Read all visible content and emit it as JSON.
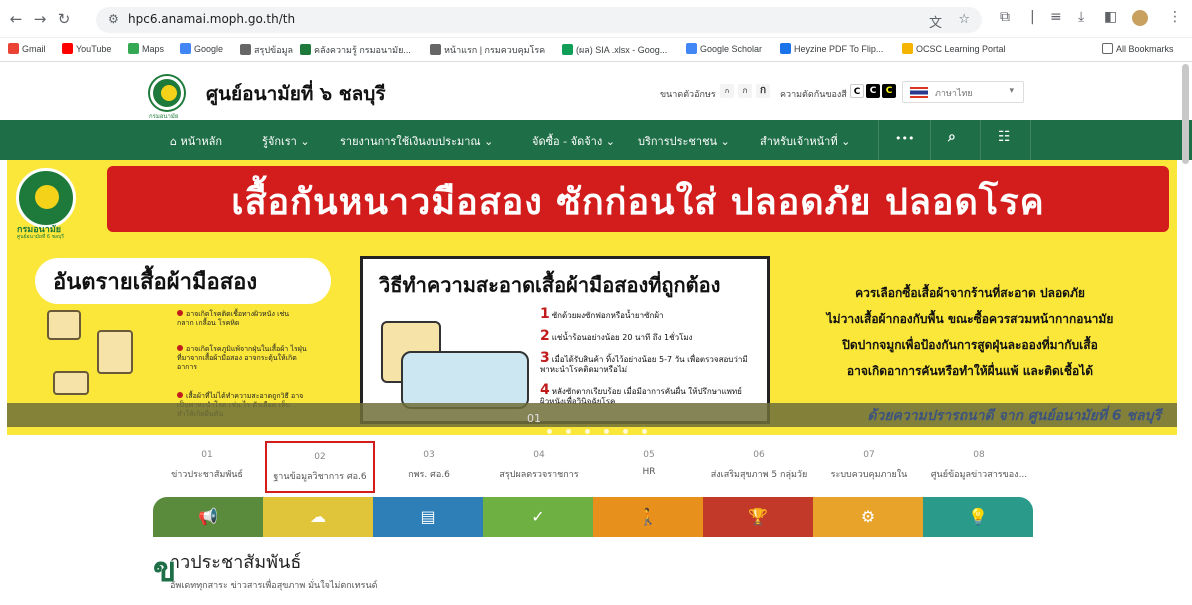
{
  "browser": {
    "url": "hpc6.anamai.moph.go.th/th",
    "bookmarks": [
      "Gmail",
      "YouTube",
      "Maps",
      "Google",
      "สรุปข้อมูล",
      "คลังความรู้ กรมอนามัย...",
      "หน้าแรก | กรมควบคุมโรค",
      "(ผล) SIA .xlsx - Goog...",
      "Google Scholar",
      "Heyzine PDF To Flip...",
      "OCSC Learning Portal"
    ],
    "all_bookmarks": "All Bookmarks"
  },
  "header": {
    "logo_caption": "กรมอนามัย",
    "site_title": "ศูนย์อนามัยที่ ๖ ชลบุรี",
    "font_size_label": "ขนาดตัวอักษร",
    "font_sizes": [
      "ก",
      "ก",
      "ก"
    ],
    "contrast_label": "ความตัดกันของสี",
    "contrast_buttons": [
      "C",
      "C",
      "C"
    ],
    "language": "ภาษาไทย"
  },
  "nav": {
    "items": [
      "หน้าหลัก",
      "รู้จักเรา ⌄",
      "รายงานการใช้เงินงบประมาณ ⌄",
      "จัดซื้อ - จัดจ้าง ⌄",
      "บริการประชาชน ⌄",
      "สำหรับเจ้าหน้าที่ ⌄",
      "•••"
    ]
  },
  "banner": {
    "title": "เสื้อกันหนาวมือสอง ซักก่อนใส่ ปลอดภัย ปลอดโรค",
    "logo_caption": "กรมอนามัย",
    "logo_caption2": "ศูนย์อนามัยที่ 6 ชลบุรี",
    "danger_title": "อันตรายเสื้อผ้ามือสอง",
    "bullets": [
      "อาจเกิดโรคติดเชื้อทางผิวหนัง เช่น กลาก เกลื้อน โรคหิด",
      "อาจเกิดโรคภูมิแพ้จากฝุ่นในเสื้อผ้า ไรฝุ่นที่มาจากเสื้อผ้ามือสอง อาจกระตุ้นให้เกิดอาการ",
      "เสื้อผ้าที่ไม่ได้ทำความสะอาดถูกวิธี อาจเป็นพาหะนำโรค เช่น ไร ตัวเลือด เห็บ ทำให้เกิดผื่นคัน"
    ],
    "clean_title": "วิธีทำความสะอาดเสื้อผ้ามือสองที่ถูกต้อง",
    "steps": [
      {
        "num": "1",
        "text": "ซักด้วยผงซักฟอกหรือน้ำยาซักผ้า"
      },
      {
        "num": "2",
        "text": "แช่น้ำร้อนอย่างน้อย 20 นาที ถึง 1ชั่วโมง"
      },
      {
        "num": "3",
        "text": "เมื่อได้รับสินค้า ทิ้งไว้อย่างน้อย 5-7 วัน เพื่อตรวจสอบว่ามีพาหะนำโรคติดมาหรือไม่"
      },
      {
        "num": "4",
        "text": "หลังซักตากเรียบร้อย เมื่อมีอาการคันผื่น ให้ปรึกษาแพทย์ผิวหนังเพื่อวินิจฉัยโรค"
      }
    ],
    "right_lines": [
      "ควรเลือกซื้อเสื้อผ้าจากร้านที่สะอาด ปลอดภัย",
      "ไม่วางเสื้อผ้ากองกับพื้น ขณะซื้อควรสวมหน้ากากอนามัย",
      "ปิดปากจมูกเพื่อป้องกันการสูดฝุ่นละอองที่มากับเสื้อ",
      "อาจเกิดอาการคันหรือทำให้ผื่นแพ้ และติดเชื้อได้"
    ],
    "footer_text": "ด้วยความปรารถนาดี จาก ศูนย์อนามัยที่ 6 ชลบุรี",
    "slide_index": "01"
  },
  "tabs": [
    {
      "num": "01",
      "label": "ข่าวประชาสัมพันธ์"
    },
    {
      "num": "02",
      "label": "ฐานข้อมูลวิชาการ ศอ.6"
    },
    {
      "num": "03",
      "label": "กพร. ศอ.6"
    },
    {
      "num": "04",
      "label": "สรุปผลตรวจราชการ"
    },
    {
      "num": "05",
      "label": "HR"
    },
    {
      "num": "06",
      "label": "ส่งเสริมสุขภาพ 5 กลุ่มวัย"
    },
    {
      "num": "07",
      "label": "ระบบควบคุมภายใน"
    },
    {
      "num": "08",
      "label": "ศูนย์ข้อมูลข่าวสารของ..."
    }
  ],
  "colorbar": [
    {
      "icon": "megaphone-icon",
      "glyph": "📢",
      "color": "#5a8a3c"
    },
    {
      "icon": "cloud-download-icon",
      "glyph": "☁",
      "color": "#e0c43a"
    },
    {
      "icon": "document-icon",
      "glyph": "▤",
      "color": "#2e7fb8"
    },
    {
      "icon": "clipboard-check-icon",
      "glyph": "✓",
      "color": "#6fb042"
    },
    {
      "icon": "person-icon",
      "glyph": "🚶",
      "color": "#e8901c"
    },
    {
      "icon": "award-icon",
      "glyph": "🏆",
      "color": "#c2392a"
    },
    {
      "icon": "gear-icon",
      "glyph": "⚙",
      "color": "#e8a42a"
    },
    {
      "icon": "lightbulb-icon",
      "glyph": "💡",
      "color": "#2a9a8a"
    }
  ],
  "news": {
    "title": "าวประชาสัมพันธ์",
    "subtitle": "อัพเดททุกสาระ ข่าวสารเพื่อสุขภาพ มั่นใจไม่ตกเทรนด์"
  }
}
